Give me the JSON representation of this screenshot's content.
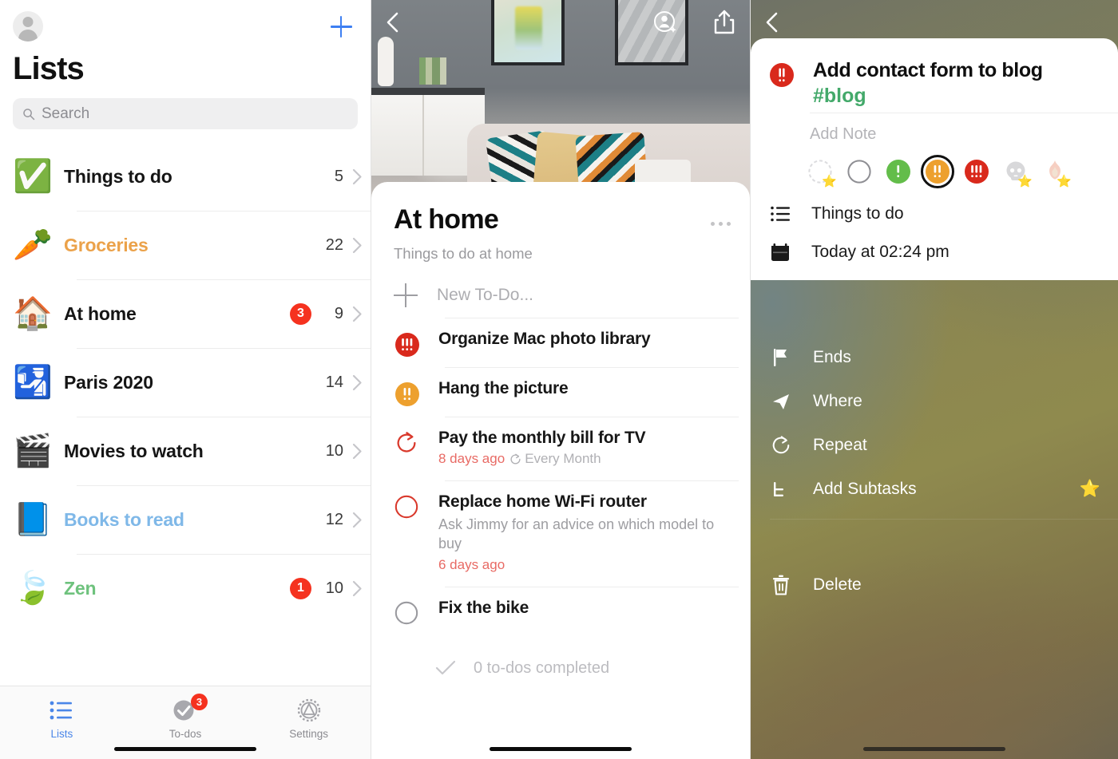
{
  "lists_panel": {
    "avatar_name": "user-avatar",
    "add_label": "+",
    "title": "Lists",
    "search": {
      "placeholder": "Search"
    },
    "items": [
      {
        "emoji": "✅",
        "label": "Things to do",
        "count": "5",
        "badge": "",
        "color": "dark"
      },
      {
        "emoji": "🥕",
        "label": "Groceries",
        "count": "22",
        "badge": "",
        "color": "orange"
      },
      {
        "emoji": "🏠",
        "label": "At home",
        "count": "9",
        "badge": "3",
        "color": "dark"
      },
      {
        "emoji": "🛂",
        "label": "Paris 2020",
        "count": "14",
        "badge": "",
        "color": "dark"
      },
      {
        "emoji": "🎬",
        "label": "Movies to watch",
        "count": "10",
        "badge": "",
        "color": "dark"
      },
      {
        "emoji": "📘",
        "label": "Books to read",
        "count": "12",
        "badge": "",
        "color": "blue"
      },
      {
        "emoji": "🍃",
        "label": "Zen",
        "count": "10",
        "badge": "1",
        "color": "green"
      }
    ],
    "tabs": [
      {
        "label": "Lists",
        "icon": "list-icon",
        "badge": "",
        "active": true
      },
      {
        "label": "To-dos",
        "icon": "check-circle-icon",
        "badge": "3",
        "active": false
      },
      {
        "label": "Settings",
        "icon": "gear-icon",
        "badge": "",
        "active": false
      }
    ]
  },
  "detail_panel": {
    "header": {
      "back_icon": "chevron-left-icon",
      "add_person_icon": "add-person-icon",
      "share_icon": "share-icon"
    },
    "title": "At home",
    "subtitle": "Things to do at home",
    "more_icon": "more-dots-icon",
    "new_todo_placeholder": "New To-Do...",
    "todos": [
      {
        "mark": "priority-high",
        "title": "Organize Mac photo library",
        "note": "",
        "overdue": "",
        "repeat": ""
      },
      {
        "mark": "priority-medium",
        "title": "Hang the picture",
        "note": "",
        "overdue": "",
        "repeat": ""
      },
      {
        "mark": "repeat",
        "title": "Pay the monthly bill for TV",
        "note": "",
        "overdue": "8 days ago",
        "repeat": "Every Month"
      },
      {
        "mark": "circle-red",
        "title": "Replace home Wi-Fi router",
        "note": "Ask Jimmy for an advice on which model to buy",
        "overdue": "6 days ago",
        "repeat": ""
      },
      {
        "mark": "circle-gray",
        "title": "Fix the bike",
        "note": "",
        "overdue": "",
        "repeat": ""
      }
    ],
    "completed_label": "0 to-dos completed",
    "completed_icon": "check-icon"
  },
  "task_panel": {
    "back_icon": "chevron-left-icon",
    "priority_icon": "priority-high-icon",
    "title": "Add contact form to blog",
    "tag": "#blog",
    "note_placeholder": "Add Note",
    "priorities": [
      {
        "name": "priority-none-starred",
        "star": "⭐",
        "selected": false
      },
      {
        "name": "priority-none",
        "star": "",
        "selected": false
      },
      {
        "name": "priority-low",
        "star": "",
        "selected": false
      },
      {
        "name": "priority-medium",
        "star": "",
        "selected": true
      },
      {
        "name": "priority-high",
        "star": "",
        "selected": false
      },
      {
        "name": "priority-skull",
        "star": "⭐",
        "selected": false
      },
      {
        "name": "priority-fire",
        "star": "⭐",
        "selected": false
      }
    ],
    "list_icon": "list-icon",
    "list_name": "Things to do",
    "date_icon": "calendar-icon",
    "date_value": "Today at 02:24 pm",
    "options": [
      {
        "label": "Ends",
        "icon": "flag-icon",
        "star": ""
      },
      {
        "label": "Where",
        "icon": "location-icon",
        "star": ""
      },
      {
        "label": "Repeat",
        "icon": "repeat-icon",
        "star": ""
      },
      {
        "label": "Add Subtasks",
        "icon": "subtask-icon",
        "star": "⭐"
      }
    ],
    "delete": {
      "label": "Delete",
      "icon": "trash-icon"
    }
  },
  "colors": {
    "accent_blue": "#3d7ff2",
    "badge_red": "#f5321f",
    "priority_high": "#d9291c",
    "priority_medium": "#eda02e",
    "priority_low": "#63bd4a",
    "tag_green": "#43a96a",
    "overdue_red": "#e86a64"
  }
}
